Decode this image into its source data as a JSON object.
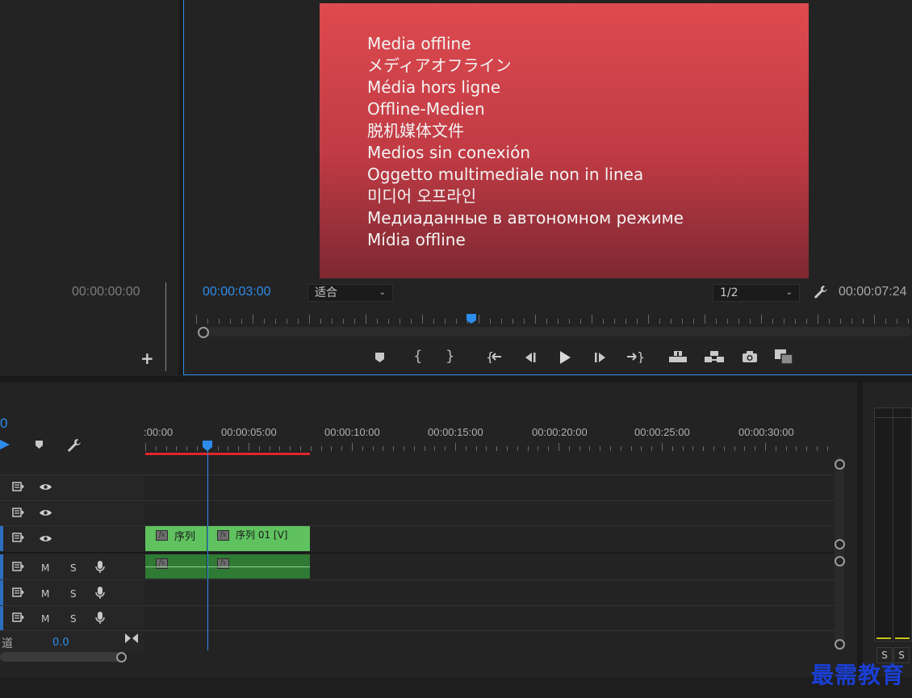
{
  "source_panel": {
    "timecode": "00:00:00:00",
    "add_label": "+"
  },
  "program_monitor": {
    "offline_lines": [
      "Media offline",
      "メディアオフライン",
      "Média hors ligne",
      "Offline-Medien",
      "脱机媒体文件",
      "Medios sin conexión",
      "Oggetto multimediale non in linea",
      "미디어 오프라인",
      "Медиаданные в автономном режиме",
      "Mídia offline"
    ],
    "current_timecode": "00:00:03:00",
    "zoom_select": "适合",
    "resolution_select": "1/2",
    "duration_timecode": "00:00:07:24",
    "accent_color": "#2d8ceb"
  },
  "transport": {
    "buttons": [
      {
        "name": "add-marker",
        "glyph": "⬟"
      },
      {
        "name": "mark-in",
        "glyph": "{"
      },
      {
        "name": "mark-out",
        "glyph": "}"
      },
      {
        "name": "go-to-in",
        "glyph": "{←"
      },
      {
        "name": "step-back",
        "glyph": "◀|"
      },
      {
        "name": "play",
        "glyph": "▶"
      },
      {
        "name": "step-forward",
        "glyph": "|▶"
      },
      {
        "name": "go-to-out",
        "glyph": "→}"
      },
      {
        "name": "lift",
        "glyph": "⇡"
      },
      {
        "name": "extract",
        "glyph": "⇞"
      },
      {
        "name": "export-frame",
        "glyph": "📷"
      },
      {
        "name": "compare-view",
        "glyph": "▣"
      }
    ]
  },
  "timeline": {
    "playhead_timecode_fragment": "0",
    "ruler_labels": [
      "00:00",
      "00:00:05:00",
      "00:00:10:00",
      "00:00:15:00",
      "00:00:20:00",
      "00:00:25:00",
      "00:00:30:00"
    ],
    "ruler_prefix": ":",
    "audio_controls": {
      "mute": "M",
      "solo": "S"
    },
    "master_label": "道",
    "master_value": "0.0",
    "clips": {
      "v1_a_name": "序列",
      "v1_b_name": "序列 01 [V]",
      "fx_label": "fx"
    },
    "clip_color": "#5fc25f",
    "audio_clip_color": "#2f7a34",
    "work_area_color": "#e0262b"
  },
  "audio_meter": {
    "solo_labels": [
      "S",
      "S"
    ]
  },
  "watermark": {
    "text": "最需教育",
    "color": "#1a3fd4"
  }
}
